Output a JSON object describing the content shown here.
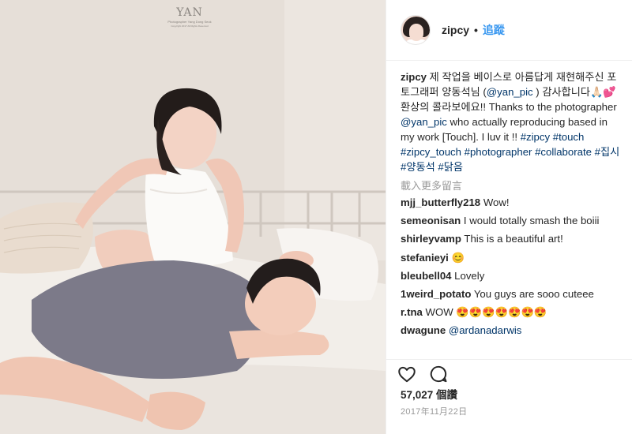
{
  "photo": {
    "watermark": {
      "logo": "YAN",
      "line1": "Photographer Yang Dong Seok",
      "line2": "Copyright 2017 All Rights Reserved"
    }
  },
  "header": {
    "username": "zipcy",
    "separator": "•",
    "follow_label": "追蹤"
  },
  "caption": {
    "username": "zipcy",
    "text_part1": " 제 작업을 베이스로 아름답게 재현해주신 포토그래퍼 양동석님 (",
    "mention1": "@yan_pic",
    "text_part2": " ) 감사합니다🙏🏻💕 환상의 콜라보에요!! Thanks to the photographer ",
    "mention2": "@yan_pic",
    "text_part3": " who actually reproducing based in my work [Touch]. I luv it !! ",
    "tags": "#zipcy #touch #zipcy_touch #photographer #collaborate #집시 #양동석 #닭음"
  },
  "load_more": "載入更多留言",
  "comments": [
    {
      "user": "mjj_butterfly218",
      "text": "Wow!"
    },
    {
      "user": "semeonisan",
      "text": "I would totally smash the boiii"
    },
    {
      "user": "shirleyvamp",
      "text": "This is a beautiful art!"
    },
    {
      "user": "stefanieyi",
      "text": "😊"
    },
    {
      "user": "bleubell04",
      "text": "Lovely"
    },
    {
      "user": "1weird_potato",
      "text": "You guys are sooo cuteee"
    },
    {
      "user": "r.tna",
      "text": "WOW 😍😍😍😍😍😍😍"
    },
    {
      "user": "dwagune",
      "text": "@ardanadarwis"
    }
  ],
  "actions": {
    "like_icon": "heart-outline-icon",
    "comment_icon": "speech-bubble-icon",
    "likes_text": "57,027 個讚",
    "date": "2017年11月22日"
  }
}
